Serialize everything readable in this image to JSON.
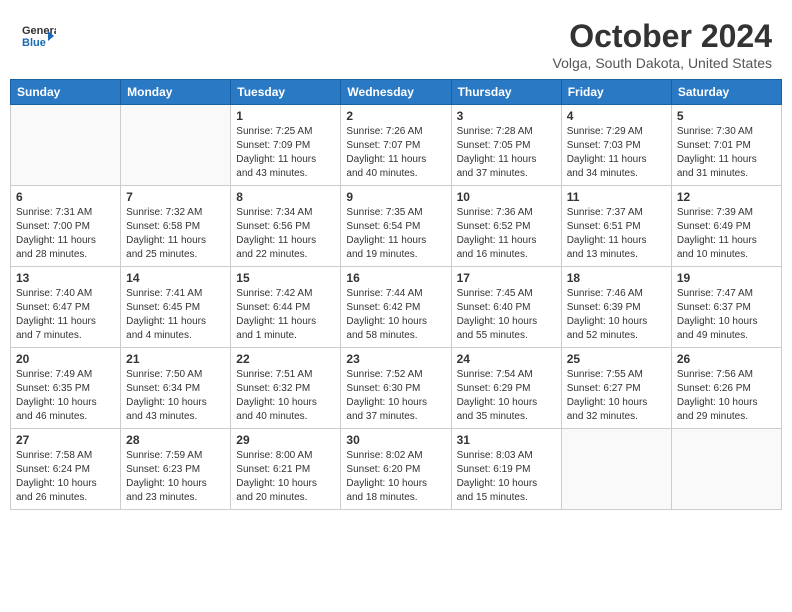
{
  "header": {
    "logo_general": "General",
    "logo_blue": "Blue",
    "month_title": "October 2024",
    "location": "Volga, South Dakota, United States"
  },
  "calendar": {
    "days_of_week": [
      "Sunday",
      "Monday",
      "Tuesday",
      "Wednesday",
      "Thursday",
      "Friday",
      "Saturday"
    ],
    "weeks": [
      [
        {
          "day": "",
          "info": ""
        },
        {
          "day": "",
          "info": ""
        },
        {
          "day": "1",
          "info": "Sunrise: 7:25 AM\nSunset: 7:09 PM\nDaylight: 11 hours and 43 minutes."
        },
        {
          "day": "2",
          "info": "Sunrise: 7:26 AM\nSunset: 7:07 PM\nDaylight: 11 hours and 40 minutes."
        },
        {
          "day": "3",
          "info": "Sunrise: 7:28 AM\nSunset: 7:05 PM\nDaylight: 11 hours and 37 minutes."
        },
        {
          "day": "4",
          "info": "Sunrise: 7:29 AM\nSunset: 7:03 PM\nDaylight: 11 hours and 34 minutes."
        },
        {
          "day": "5",
          "info": "Sunrise: 7:30 AM\nSunset: 7:01 PM\nDaylight: 11 hours and 31 minutes."
        }
      ],
      [
        {
          "day": "6",
          "info": "Sunrise: 7:31 AM\nSunset: 7:00 PM\nDaylight: 11 hours and 28 minutes."
        },
        {
          "day": "7",
          "info": "Sunrise: 7:32 AM\nSunset: 6:58 PM\nDaylight: 11 hours and 25 minutes."
        },
        {
          "day": "8",
          "info": "Sunrise: 7:34 AM\nSunset: 6:56 PM\nDaylight: 11 hours and 22 minutes."
        },
        {
          "day": "9",
          "info": "Sunrise: 7:35 AM\nSunset: 6:54 PM\nDaylight: 11 hours and 19 minutes."
        },
        {
          "day": "10",
          "info": "Sunrise: 7:36 AM\nSunset: 6:52 PM\nDaylight: 11 hours and 16 minutes."
        },
        {
          "day": "11",
          "info": "Sunrise: 7:37 AM\nSunset: 6:51 PM\nDaylight: 11 hours and 13 minutes."
        },
        {
          "day": "12",
          "info": "Sunrise: 7:39 AM\nSunset: 6:49 PM\nDaylight: 11 hours and 10 minutes."
        }
      ],
      [
        {
          "day": "13",
          "info": "Sunrise: 7:40 AM\nSunset: 6:47 PM\nDaylight: 11 hours and 7 minutes."
        },
        {
          "day": "14",
          "info": "Sunrise: 7:41 AM\nSunset: 6:45 PM\nDaylight: 11 hours and 4 minutes."
        },
        {
          "day": "15",
          "info": "Sunrise: 7:42 AM\nSunset: 6:44 PM\nDaylight: 11 hours and 1 minute."
        },
        {
          "day": "16",
          "info": "Sunrise: 7:44 AM\nSunset: 6:42 PM\nDaylight: 10 hours and 58 minutes."
        },
        {
          "day": "17",
          "info": "Sunrise: 7:45 AM\nSunset: 6:40 PM\nDaylight: 10 hours and 55 minutes."
        },
        {
          "day": "18",
          "info": "Sunrise: 7:46 AM\nSunset: 6:39 PM\nDaylight: 10 hours and 52 minutes."
        },
        {
          "day": "19",
          "info": "Sunrise: 7:47 AM\nSunset: 6:37 PM\nDaylight: 10 hours and 49 minutes."
        }
      ],
      [
        {
          "day": "20",
          "info": "Sunrise: 7:49 AM\nSunset: 6:35 PM\nDaylight: 10 hours and 46 minutes."
        },
        {
          "day": "21",
          "info": "Sunrise: 7:50 AM\nSunset: 6:34 PM\nDaylight: 10 hours and 43 minutes."
        },
        {
          "day": "22",
          "info": "Sunrise: 7:51 AM\nSunset: 6:32 PM\nDaylight: 10 hours and 40 minutes."
        },
        {
          "day": "23",
          "info": "Sunrise: 7:52 AM\nSunset: 6:30 PM\nDaylight: 10 hours and 37 minutes."
        },
        {
          "day": "24",
          "info": "Sunrise: 7:54 AM\nSunset: 6:29 PM\nDaylight: 10 hours and 35 minutes."
        },
        {
          "day": "25",
          "info": "Sunrise: 7:55 AM\nSunset: 6:27 PM\nDaylight: 10 hours and 32 minutes."
        },
        {
          "day": "26",
          "info": "Sunrise: 7:56 AM\nSunset: 6:26 PM\nDaylight: 10 hours and 29 minutes."
        }
      ],
      [
        {
          "day": "27",
          "info": "Sunrise: 7:58 AM\nSunset: 6:24 PM\nDaylight: 10 hours and 26 minutes."
        },
        {
          "day": "28",
          "info": "Sunrise: 7:59 AM\nSunset: 6:23 PM\nDaylight: 10 hours and 23 minutes."
        },
        {
          "day": "29",
          "info": "Sunrise: 8:00 AM\nSunset: 6:21 PM\nDaylight: 10 hours and 20 minutes."
        },
        {
          "day": "30",
          "info": "Sunrise: 8:02 AM\nSunset: 6:20 PM\nDaylight: 10 hours and 18 minutes."
        },
        {
          "day": "31",
          "info": "Sunrise: 8:03 AM\nSunset: 6:19 PM\nDaylight: 10 hours and 15 minutes."
        },
        {
          "day": "",
          "info": ""
        },
        {
          "day": "",
          "info": ""
        }
      ]
    ]
  }
}
